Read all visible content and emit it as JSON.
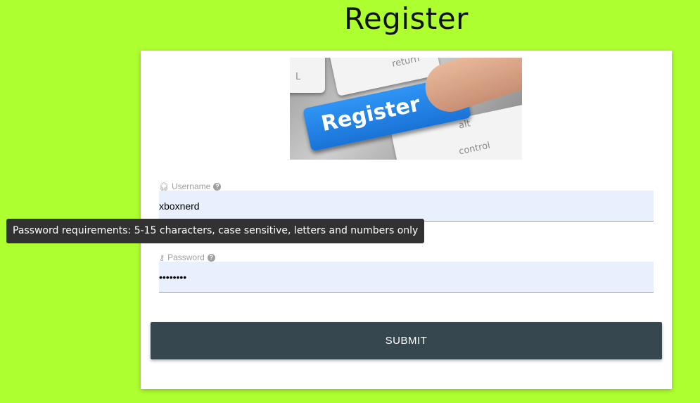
{
  "page": {
    "title": "Register"
  },
  "hero_image": {
    "key_label": "Register",
    "key_labels": [
      "return",
      "L",
      "alt",
      "control"
    ]
  },
  "form": {
    "username": {
      "label": "Username",
      "value": "xboxnerd",
      "icon": "headset-icon",
      "help_icon": "help-circle-icon"
    },
    "password": {
      "label": "Password",
      "value": "••••••••",
      "icon": "key-icon",
      "help_icon": "help-circle-icon"
    },
    "submit_label": "SUBMIT"
  },
  "tooltip": {
    "text": "Password requirements: 5-15 characters, case sensitive, letters and numbers only"
  },
  "colors": {
    "background": "#adff2f",
    "button": "#37474f",
    "input_fill": "#e8f0fe",
    "tooltip": "#323232"
  }
}
